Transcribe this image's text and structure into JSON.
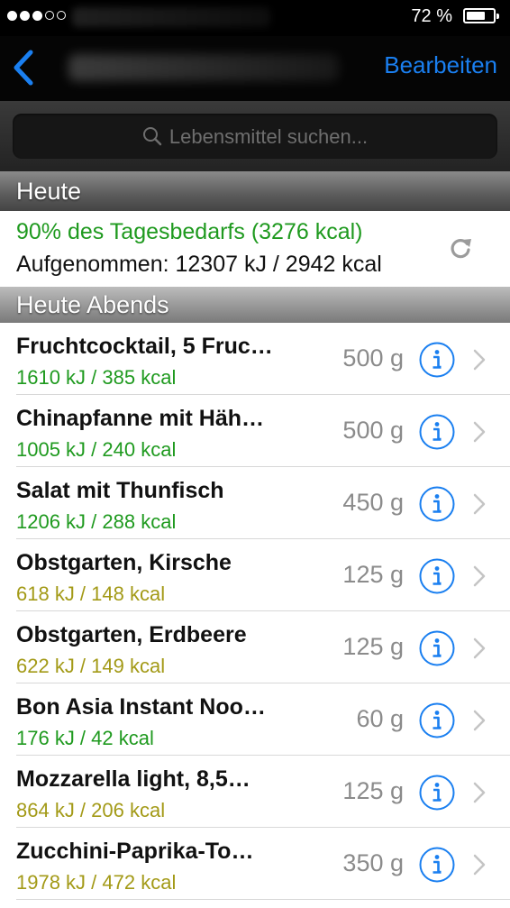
{
  "status": {
    "battery_text": "72 %",
    "battery_level": 0.72
  },
  "nav": {
    "edit_label": "Bearbeiten"
  },
  "search": {
    "placeholder": "Lebensmittel suchen..."
  },
  "today": {
    "header": "Heute",
    "percent_text": "90% des Tagesbedarfs (3276 kcal)",
    "consumed_text": "Aufgenommen: 12307 kJ / 2942 kcal"
  },
  "evening": {
    "header": "Heute Abends"
  },
  "colors": {
    "accent": "#1a7ff0",
    "green": "#1f9a1f",
    "olive": "#a39a17"
  },
  "items": [
    {
      "name": "Fruchtcocktail, 5 Fruc…",
      "energy": "1610 kJ / 385 kcal",
      "amount": "500 g",
      "color": "#1f9a1f"
    },
    {
      "name": "Chinapfanne mit Häh…",
      "energy": "1005 kJ / 240 kcal",
      "amount": "500 g",
      "color": "#1f9a1f"
    },
    {
      "name": "Salat mit Thunfisch",
      "energy": "1206 kJ / 288 kcal",
      "amount": "450 g",
      "color": "#1f9a1f"
    },
    {
      "name": "Obstgarten, Kirsche",
      "energy": "618 kJ / 148 kcal",
      "amount": "125 g",
      "color": "#a39a17"
    },
    {
      "name": "Obstgarten, Erdbeere",
      "energy": "622 kJ / 149 kcal",
      "amount": "125 g",
      "color": "#a39a17"
    },
    {
      "name": "Bon Asia Instant Noo…",
      "energy": "176 kJ / 42 kcal",
      "amount": "60 g",
      "color": "#1f9a1f"
    },
    {
      "name": "Mozzarella light, 8,5…",
      "energy": "864 kJ / 206 kcal",
      "amount": "125 g",
      "color": "#a39a17"
    },
    {
      "name": "Zucchini-Paprika-To…",
      "energy": "1978 kJ / 472 kcal",
      "amount": "350 g",
      "color": "#a39a17"
    }
  ]
}
